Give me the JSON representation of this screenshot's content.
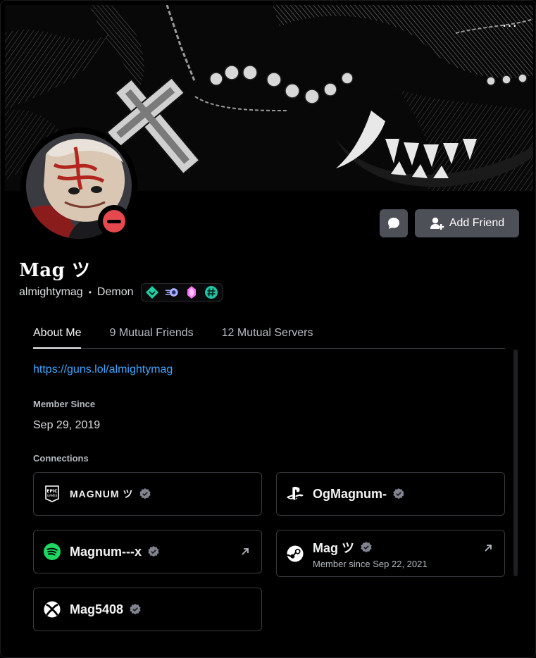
{
  "profile": {
    "display_name": "Mag ツ",
    "username": "almightymag",
    "separator": "•",
    "pronoun_tag": "Demon",
    "status": "do-not-disturb",
    "status_color": "#e5484d",
    "badges": [
      {
        "icon": "nitro-diamond-badge-icon",
        "color": "#1fd1a2"
      },
      {
        "icon": "speed-boost-badge-icon",
        "color": "#aab0ff"
      },
      {
        "icon": "pink-gem-badge-icon",
        "color": "#ff73fa"
      },
      {
        "icon": "hashtag-badge-icon",
        "color": "#23c3a5"
      }
    ]
  },
  "banner": {
    "more_label": "···"
  },
  "actions": {
    "message_icon": "chat-bubble-icon",
    "add_friend_label": "Add Friend"
  },
  "tabs": [
    {
      "label": "About Me",
      "active": true
    },
    {
      "label": "9 Mutual Friends",
      "active": false
    },
    {
      "label": "12 Mutual Servers",
      "active": false
    }
  ],
  "about": {
    "link": "https://guns.lol/almightymag",
    "member_since_heading": "Member Since",
    "member_since_value": "Sep 29, 2019",
    "connections_heading": "Connections"
  },
  "connections": [
    {
      "service": "Epic Games",
      "icon": "epic-games-icon",
      "name": "MAGNUM ツ",
      "verified": true,
      "external": false
    },
    {
      "service": "PlayStation",
      "icon": "playstation-icon",
      "name": "OgMagnum-",
      "verified": true,
      "external": false
    },
    {
      "service": "Spotify",
      "icon": "spotify-icon",
      "name": "Magnum---x",
      "verified": true,
      "external": true
    },
    {
      "service": "Steam",
      "icon": "steam-icon",
      "name": "Mag ツ",
      "verified": true,
      "external": true,
      "subtitle": "Member since Sep 22, 2021"
    },
    {
      "service": "Xbox",
      "icon": "xbox-icon",
      "name": "Mag5408",
      "verified": true,
      "external": false
    }
  ],
  "colors": {
    "link": "#3ea5ff",
    "button": "#4e5058",
    "spotify": "#1ed760"
  }
}
